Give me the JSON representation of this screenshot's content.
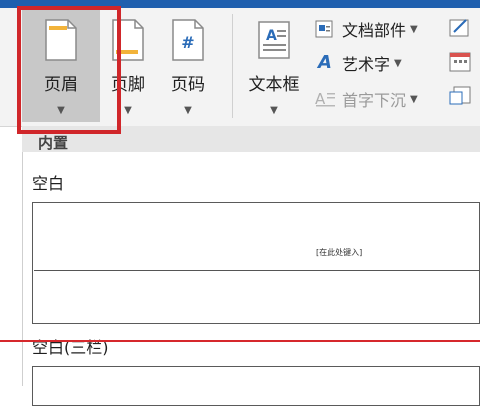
{
  "ribbon": {
    "header": {
      "label": "页眉"
    },
    "footer": {
      "label": "页脚"
    },
    "page_number": {
      "label": "页码",
      "icon_glyph": "#"
    },
    "textbox": {
      "label": "文本框"
    },
    "quick_parts": {
      "label": "文档部件"
    },
    "wordart": {
      "label": "艺术字"
    },
    "drop_cap": {
      "label": "首字下沉"
    }
  },
  "gallery": {
    "section_label": "内置",
    "items": [
      {
        "title": "空白",
        "placeholder": "[在此处键入]"
      },
      {
        "title": "空白(三栏)"
      }
    ]
  },
  "colors": {
    "accent": "#1f5fae",
    "highlight": "#d0262a"
  }
}
